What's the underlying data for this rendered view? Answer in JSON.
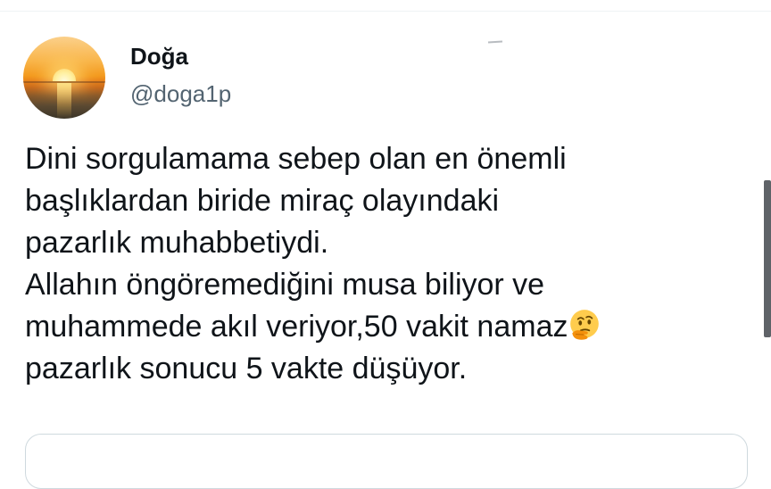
{
  "tweet": {
    "display_name": "Doğa",
    "handle": "@doga1p",
    "text_main": "Dini sorgulamama sebep olan en önemli\nbaşlıklardan biride miraç olayındaki\npazarlık muhabbetiydi.\nAllahın öngöremediğini musa biliyor ve\nmuhammede akıl veriyor,50 vakit namaz",
    "text_tail": "\npazarlık sonucu  5 vakte düşüyor.",
    "emoji": "thinking-face-icon",
    "avatar": "sunset-over-sea-image"
  },
  "colors": {
    "text_primary": "#0f1419",
    "text_secondary": "#536471",
    "divider": "#eff3f4",
    "card_border": "#cfd9de"
  }
}
